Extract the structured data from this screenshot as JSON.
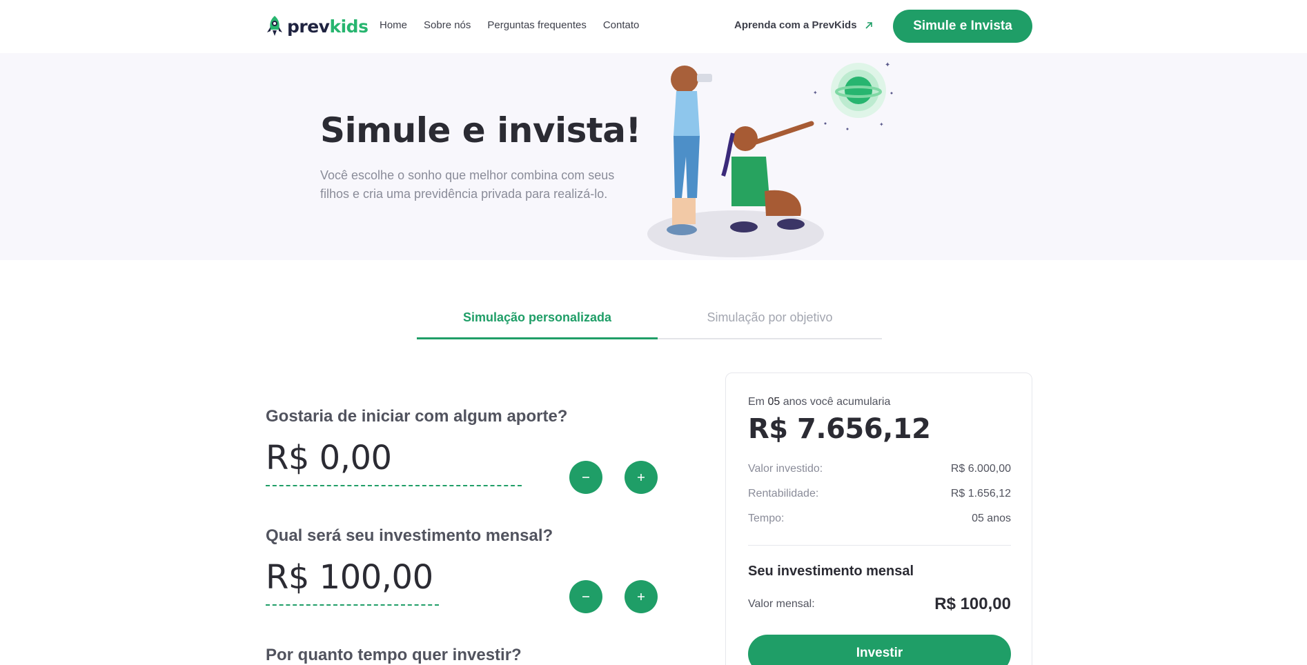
{
  "brand": {
    "name_prefix": "prev",
    "name_suffix": "kids",
    "green": "#27b56f",
    "navy": "#1f2340"
  },
  "colors": {
    "primary": "#1f9e67",
    "hero_bg": "#f8f7fc"
  },
  "nav": {
    "items": [
      "Home",
      "Sobre nós",
      "Perguntas frequentes",
      "Contato"
    ]
  },
  "header": {
    "learn_label": "Aprenda com a PrevKids",
    "cta_label": "Simule e Invista"
  },
  "hero": {
    "title": "Simule e invista!",
    "subtitle_line1": "Você escolhe o sonho que melhor combina com seus",
    "subtitle_line2": "filhos e cria uma previdência privada para realizá-lo."
  },
  "tabs": [
    {
      "label": "Simulação personalizada",
      "active": true
    },
    {
      "label": "Simulação por objetivo",
      "active": false
    }
  ],
  "form": {
    "initial": {
      "question": "Gostaria de iniciar com algum aporte?",
      "value": "R$ 0,00"
    },
    "monthly": {
      "question": "Qual será seu investimento mensal?",
      "value": "R$ 100,00"
    },
    "period": {
      "question": "Por quanto tempo quer investir?"
    }
  },
  "result": {
    "head_prefix": "Em",
    "head_years": "05",
    "head_suffix": "anos você acumularia",
    "total": "R$ 7.656,12",
    "rows": [
      {
        "label": "Valor investido:",
        "value": "R$ 6.000,00"
      },
      {
        "label": "Rentabilidade:",
        "value": "R$ 1.656,12"
      },
      {
        "label": "Tempo:",
        "value": "05 anos"
      }
    ],
    "monthly_title": "Seu investimento mensal",
    "monthly_label": "Valor mensal:",
    "monthly_value": "R$ 100,00",
    "invest_label": "Investir"
  },
  "icons": [
    "rocket-logo-icon",
    "arrow-up-right-icon",
    "minus-icon",
    "plus-icon"
  ]
}
